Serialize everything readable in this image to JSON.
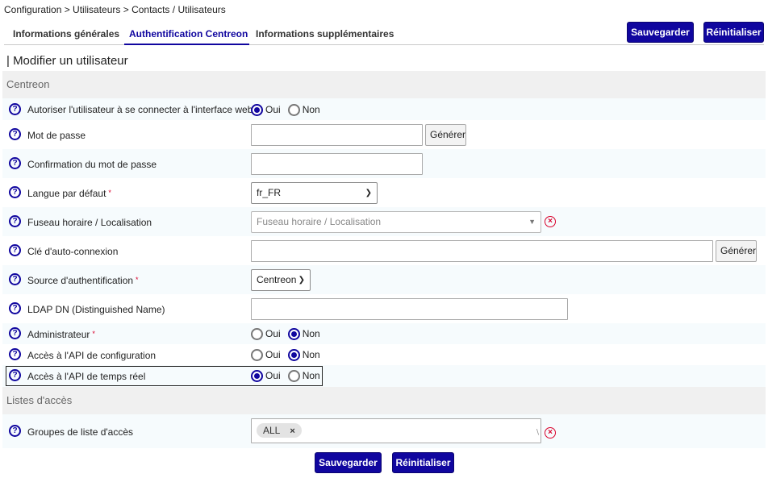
{
  "breadcrumb": "Configuration  >  Utilisateurs  >  Contacts / Utilisateurs",
  "tabs": [
    {
      "label": "Informations générales",
      "active": false
    },
    {
      "label": "Authentification Centreon",
      "active": true
    },
    {
      "label": "Informations supplémentaires",
      "active": false
    }
  ],
  "buttons": {
    "save": "Sauvegarder",
    "reset": "Réinitialiser"
  },
  "page_title": "| Modifier un utilisateur",
  "sections": {
    "centreon": "Centreon",
    "acl": "Listes d'accès"
  },
  "fields": {
    "web_access": {
      "label": "Autoriser l'utilisateur à se connecter à l'interface web",
      "required": "*",
      "yes": "Oui",
      "no": "Non",
      "selected": "Oui"
    },
    "password": {
      "label": "Mot de passe",
      "value": "",
      "generate": "Générer"
    },
    "password_confirm": {
      "label": "Confirmation du mot de passe",
      "value": ""
    },
    "language": {
      "label": "Langue par défaut",
      "required": "*",
      "value": "fr_FR"
    },
    "timezone": {
      "label": "Fuseau horaire / Localisation",
      "placeholder": "Fuseau horaire / Localisation"
    },
    "autologin": {
      "label": "Clé d'auto-connexion",
      "value": "",
      "generate": "Générer"
    },
    "auth_source": {
      "label": "Source d'authentification",
      "required": "*",
      "value": "Centreon"
    },
    "ldap_dn": {
      "label": "LDAP DN (Distinguished Name)",
      "value": ""
    },
    "admin": {
      "label": "Administrateur",
      "required": "*",
      "yes": "Oui",
      "no": "Non",
      "selected": "Non"
    },
    "api_config": {
      "label": "Accès à l'API de configuration",
      "yes": "Oui",
      "no": "Non",
      "selected": "Non"
    },
    "api_realtime": {
      "label": "Accès à l'API de temps réel",
      "yes": "Oui",
      "no": "Non",
      "selected": "Oui"
    },
    "acl_groups": {
      "label": "Groupes de liste d'accès",
      "chips": [
        "ALL"
      ],
      "chip_remove": "×"
    }
  },
  "icons": {
    "help": "help-circle-icon",
    "clear": "clear-circle-icon",
    "chevron": "chevron-down-icon"
  },
  "colors": {
    "primary": "#10069f",
    "danger": "#d9002b",
    "row_alt": "#f6fbfd",
    "section": "#f0f0f0"
  }
}
